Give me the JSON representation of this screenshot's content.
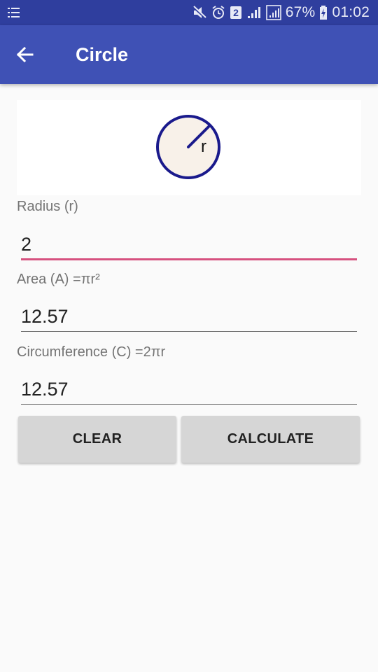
{
  "status_bar": {
    "left_icon": "notification-list-icon",
    "icons": [
      "mute-icon",
      "alarm-icon",
      "sim-2-icon",
      "signal-icon",
      "signal-boxed-icon"
    ],
    "battery_percent": "67%",
    "battery_icon": "battery-charging-icon",
    "time": "01:02"
  },
  "app_bar": {
    "back_icon": "arrow-back-icon",
    "title": "Circle"
  },
  "diagram": {
    "label": "r",
    "fill_color": "#f8f1e9",
    "stroke_color": "#1a1a8c"
  },
  "fields": {
    "radius": {
      "label": "Radius (r)",
      "value": "2"
    },
    "area": {
      "label": "Area (A) =πr²",
      "value": "12.57"
    },
    "circumference": {
      "label": "Circumference (C) =2πr",
      "value": "12.57"
    }
  },
  "buttons": {
    "clear": "CLEAR",
    "calculate": "CALCULATE"
  },
  "colors": {
    "status_bar": "#2f3e9e",
    "app_bar": "#3f51b5",
    "accent": "#d6517f",
    "background": "#fafafa"
  }
}
